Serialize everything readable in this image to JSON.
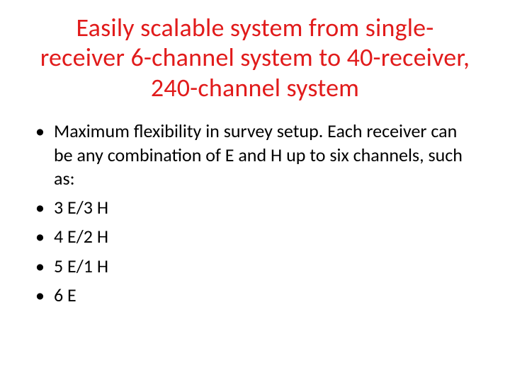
{
  "title": "Easily scalable system from single-receiver 6-channel system to 40-receiver, 240-channel system",
  "bullets": [
    "Maximum flexibility in survey setup.  Each receiver can be any combination of E and H up to six channels, such as:",
    "3 E/3 H",
    "4 E/2 H",
    "5 E/1 H",
    "6 E"
  ]
}
